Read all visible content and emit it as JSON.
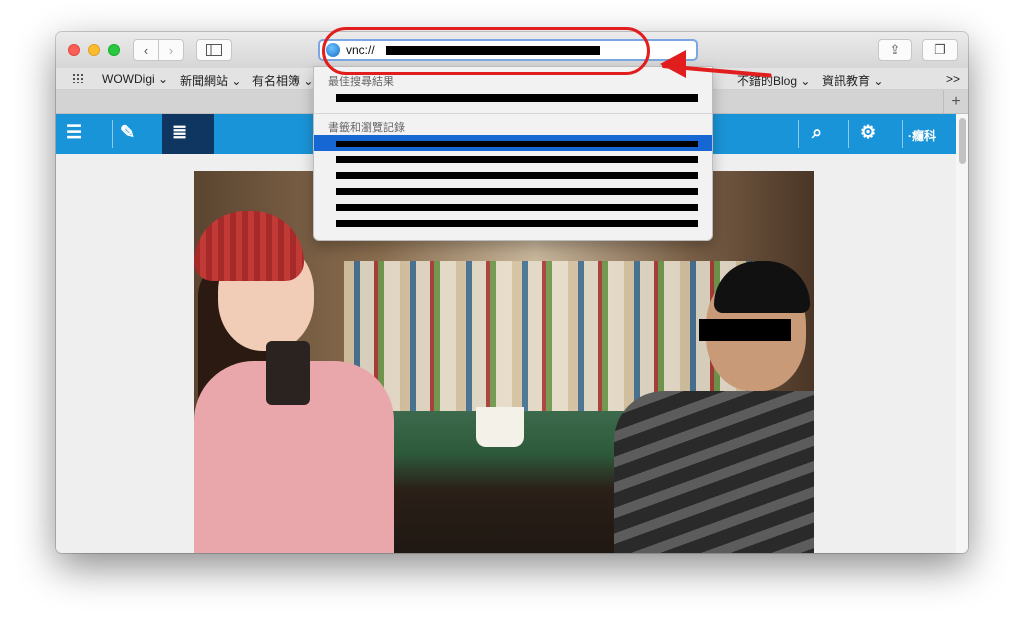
{
  "toolbar": {
    "back_glyph": "‹",
    "forward_glyph": "›",
    "url_text": "vnc://",
    "share_glyph": "⇪",
    "tabs_glyph": "❐"
  },
  "favorites": {
    "items": [
      {
        "label": "WOWDigi ⌄"
      },
      {
        "label": "新聞網站 ⌄"
      },
      {
        "label": "有名相簿 ⌄"
      },
      {
        "label": "不錯的Blog ⌄"
      },
      {
        "label": "資訊教育 ⌄"
      }
    ],
    "more": ">>"
  },
  "tabstrip": {
    "new_tab": "+"
  },
  "site": {
    "right_label": "·癮科"
  },
  "dropdown": {
    "top_hit_header": "最佳搜尋結果",
    "history_header": "書籤和瀏覽記錄"
  },
  "colors": {
    "site_bar": "#1a94d8",
    "annotation_red": "#e21d1d",
    "selection_blue": "#1667d4"
  }
}
